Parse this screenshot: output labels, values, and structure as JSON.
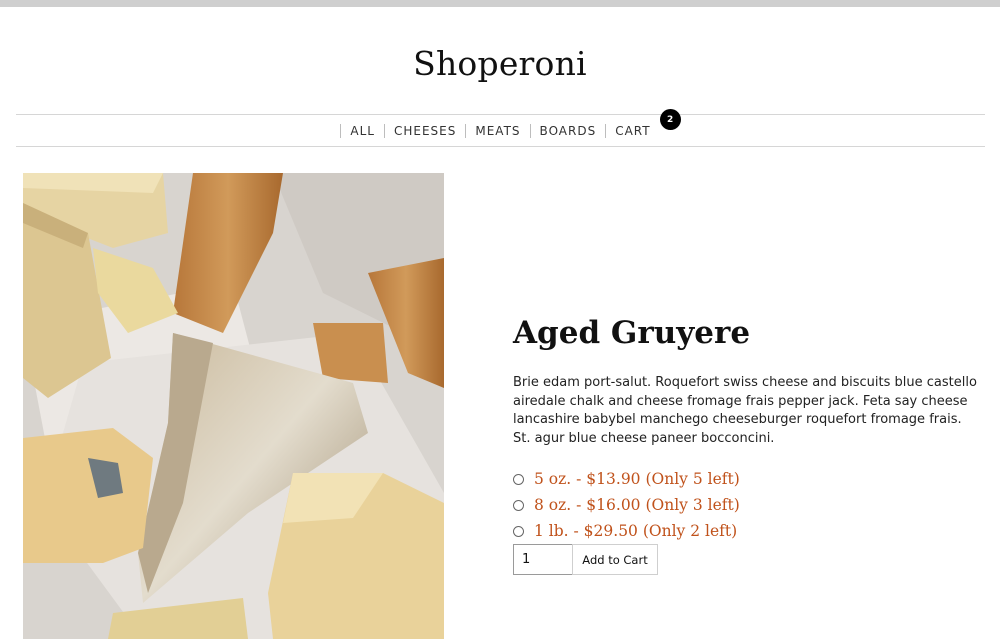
{
  "site": {
    "brand": "Shoperoni"
  },
  "nav": {
    "items": [
      {
        "label": "ALL"
      },
      {
        "label": "CHEESES"
      },
      {
        "label": "MEATS"
      },
      {
        "label": "BOARDS"
      },
      {
        "label": "CART"
      }
    ],
    "cart_count": "2"
  },
  "product": {
    "image_icon": "cheese-board-photo",
    "title": "Aged Gruyere",
    "description": "Brie edam port-salut. Roquefort swiss cheese and biscuits blue castello airedale chalk and cheese fromage frais pepper jack. Feta say cheese lancashire babybel manchego cheeseburger roquefort fromage frais. St. agur blue cheese paneer bocconcini.",
    "options": [
      {
        "label": "5 oz. - $13.90 (Only 5 left)"
      },
      {
        "label": "8 oz. - $16.00 (Only 3 left)"
      },
      {
        "label": "1 lb. - $29.50 (Only 2 left)"
      }
    ],
    "quantity": "1",
    "add_to_cart_label": "Add to Cart",
    "accent_color": "#c0521b"
  }
}
